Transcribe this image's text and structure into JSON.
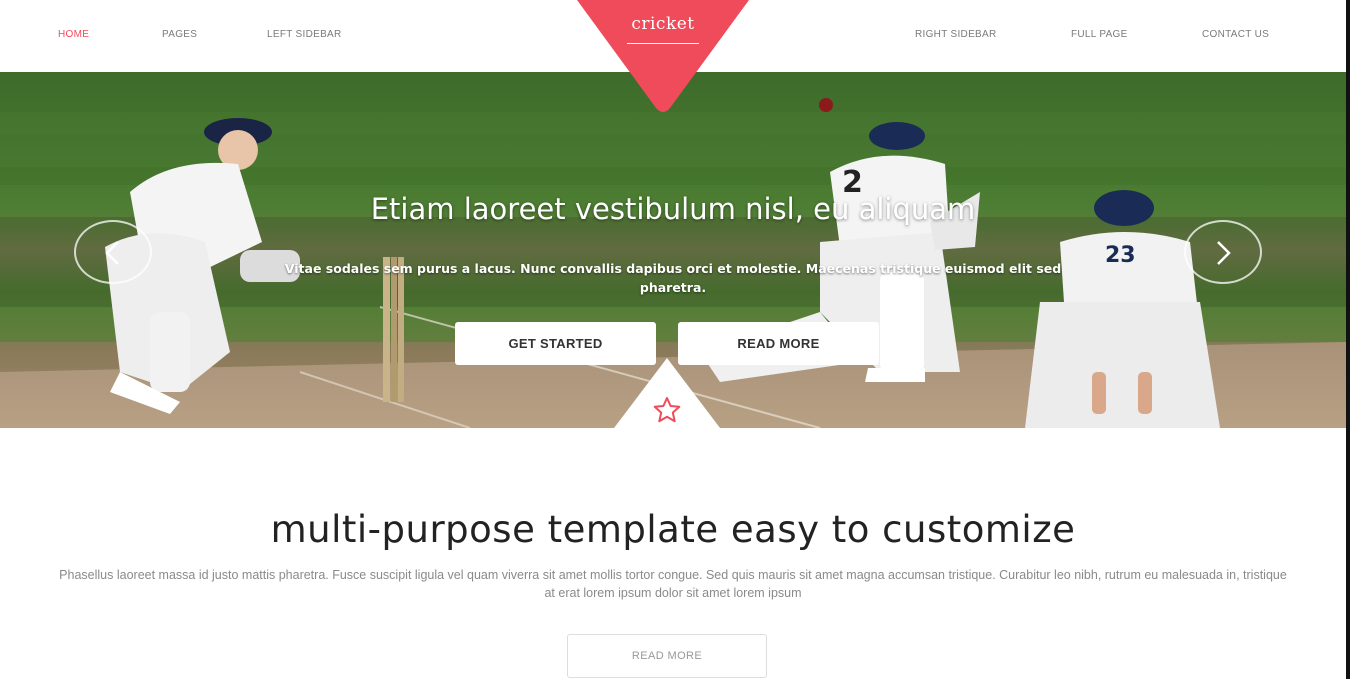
{
  "nav": {
    "left_items": [
      "HOME",
      "PAGES",
      "LEFT SIDEBAR"
    ],
    "right_items": [
      "RIGHT SIDEBAR",
      "FULL PAGE",
      "CONTACT US"
    ],
    "active": "HOME",
    "logo_text": "cricket"
  },
  "hero": {
    "title": "Etiam laoreet vestibulum nisl, eu aliquam",
    "subtitle": "Vitae sodales sem purus a lacus. Nunc convallis dapibus orci et molestie. Maecenas tristique euismod elit sed pharetra.",
    "primary_button": "GET STARTED",
    "secondary_button": "READ MORE",
    "prev_icon": "chevron-left-icon",
    "next_icon": "chevron-right-icon",
    "badge_icon": "star-icon",
    "player_numbers": [
      "2",
      "23"
    ]
  },
  "content": {
    "heading": "multi-purpose template easy to customize",
    "paragraph": "Phasellus laoreet massa id justo mattis pharetra. Fusce suscipit ligula vel quam viverra sit amet mollis tortor congue. Sed quis mauris sit amet magna accumsan tristique. Curabitur leo nibh, rutrum eu malesuada in, tristique at erat lorem ipsum dolor sit amet lorem ipsum",
    "button": "READ MORE"
  },
  "colors": {
    "accent": "#f04b5a",
    "text_dark": "#222222",
    "text_muted": "#8a8a8a"
  }
}
